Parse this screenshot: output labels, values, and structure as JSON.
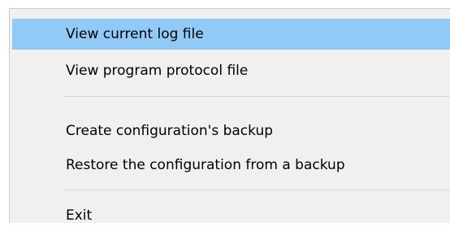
{
  "menu": {
    "items": [
      {
        "label": "View current log file",
        "highlighted": true
      },
      {
        "label": "View program protocol file",
        "highlighted": false
      },
      {
        "label": "Create configuration's backup",
        "highlighted": false
      },
      {
        "label": "Restore the configuration from a backup",
        "highlighted": false
      },
      {
        "label": "Exit",
        "highlighted": false
      }
    ],
    "highlight_color": "#91c9f7",
    "background_color": "#f0f0f0"
  }
}
